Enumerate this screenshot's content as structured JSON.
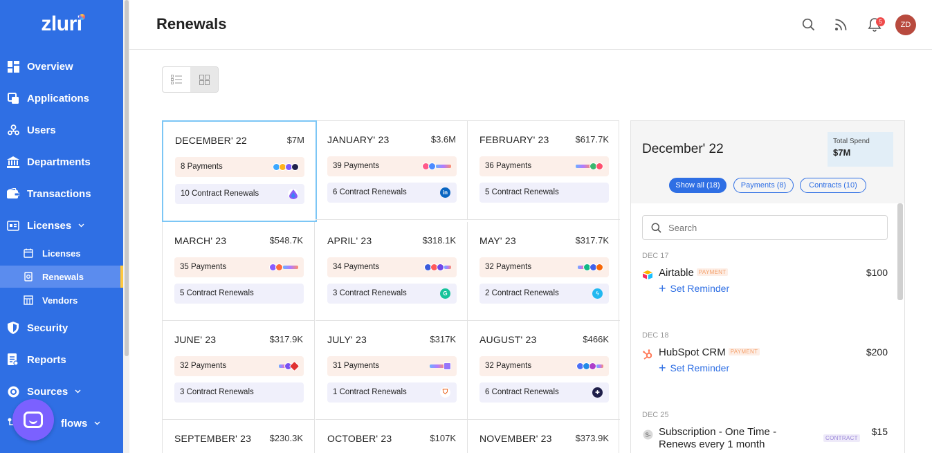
{
  "brand": {
    "name": "zluri"
  },
  "nav": {
    "items": [
      {
        "label": "Overview",
        "icon": "dashboard-icon"
      },
      {
        "label": "Applications",
        "icon": "applications-icon"
      },
      {
        "label": "Users",
        "icon": "users-icon"
      },
      {
        "label": "Departments",
        "icon": "building-icon"
      },
      {
        "label": "Transactions",
        "icon": "wallet-icon"
      },
      {
        "label": "Licenses",
        "icon": "license-icon",
        "chevron": "⌄"
      },
      {
        "label": "Security",
        "icon": "shield-icon"
      },
      {
        "label": "Reports",
        "icon": "report-icon"
      },
      {
        "label": "Sources",
        "icon": "sources-icon",
        "chevron": "⌄"
      },
      {
        "label": "flows",
        "icon": "workflows-icon",
        "chevron": "⌄"
      }
    ],
    "sub_items": [
      {
        "label": "Licenses",
        "icon": "calendar-icon"
      },
      {
        "label": "Renewals",
        "icon": "renewal-icon",
        "active": true
      },
      {
        "label": "Vendors",
        "icon": "vendors-icon"
      }
    ]
  },
  "header": {
    "title": "Renewals",
    "notification_count": "5",
    "avatar_initials": "ZD"
  },
  "months": [
    {
      "month": "DECEMBER' 22",
      "amount": "$7M",
      "payments": "8 Payments",
      "contracts": "10 Contract Renewals",
      "selected": true
    },
    {
      "month": "JANUARY' 23",
      "amount": "$3.6M",
      "payments": "39 Payments",
      "contracts": "6 Contract Renewals"
    },
    {
      "month": "FEBRUARY' 23",
      "amount": "$617.7K",
      "payments": "36 Payments",
      "contracts": "5 Contract Renewals"
    },
    {
      "month": "MARCH' 23",
      "amount": "$548.7K",
      "payments": "35 Payments",
      "contracts": "5 Contract Renewals"
    },
    {
      "month": "APRIL' 23",
      "amount": "$318.1K",
      "payments": "34 Payments",
      "contracts": "3 Contract Renewals"
    },
    {
      "month": "MAY' 23",
      "amount": "$317.7K",
      "payments": "32 Payments",
      "contracts": "2 Contract Renewals"
    },
    {
      "month": "JUNE' 23",
      "amount": "$317.9K",
      "payments": "32 Payments",
      "contracts": "3 Contract Renewals"
    },
    {
      "month": "JULY' 23",
      "amount": "$317K",
      "payments": "31 Payments",
      "contracts": "1 Contract Renewals"
    },
    {
      "month": "AUGUST' 23",
      "amount": "$466K",
      "payments": "32 Payments",
      "contracts": "6 Contract Renewals"
    },
    {
      "month": "SEPTEMBER' 23",
      "amount": "$230.3K"
    },
    {
      "month": "OCTOBER' 23",
      "amount": "$107K"
    },
    {
      "month": "NOVEMBER' 23",
      "amount": "$373.9K"
    }
  ],
  "panel": {
    "title": "December' 22",
    "total_spend_label": "Total Spend",
    "total_spend_value": "$7M",
    "filters": [
      "Show all (18)",
      "Payments (8)",
      "Contracts (10)"
    ],
    "search_placeholder": "Search",
    "groups": [
      {
        "date": "DEC 17",
        "name": "Airtable",
        "tag": "PAYMENT",
        "amount": "$100",
        "reminder": "Set Reminder"
      },
      {
        "date": "DEC 18",
        "name": "HubSpot CRM",
        "tag": "PAYMENT",
        "amount": "$200",
        "reminder": "Set Reminder"
      },
      {
        "date": "DEC 25",
        "name": "Subscription - One Time -",
        "name2": "Renews every 1 month",
        "tag": "CONTRACT",
        "amount": "$15"
      }
    ]
  },
  "colors": {
    "primary": "#2f6fe4",
    "payment_bg": "#fcefe9",
    "contract_bg": "#f0f0fb",
    "selected_border": "#7cc6f5"
  }
}
